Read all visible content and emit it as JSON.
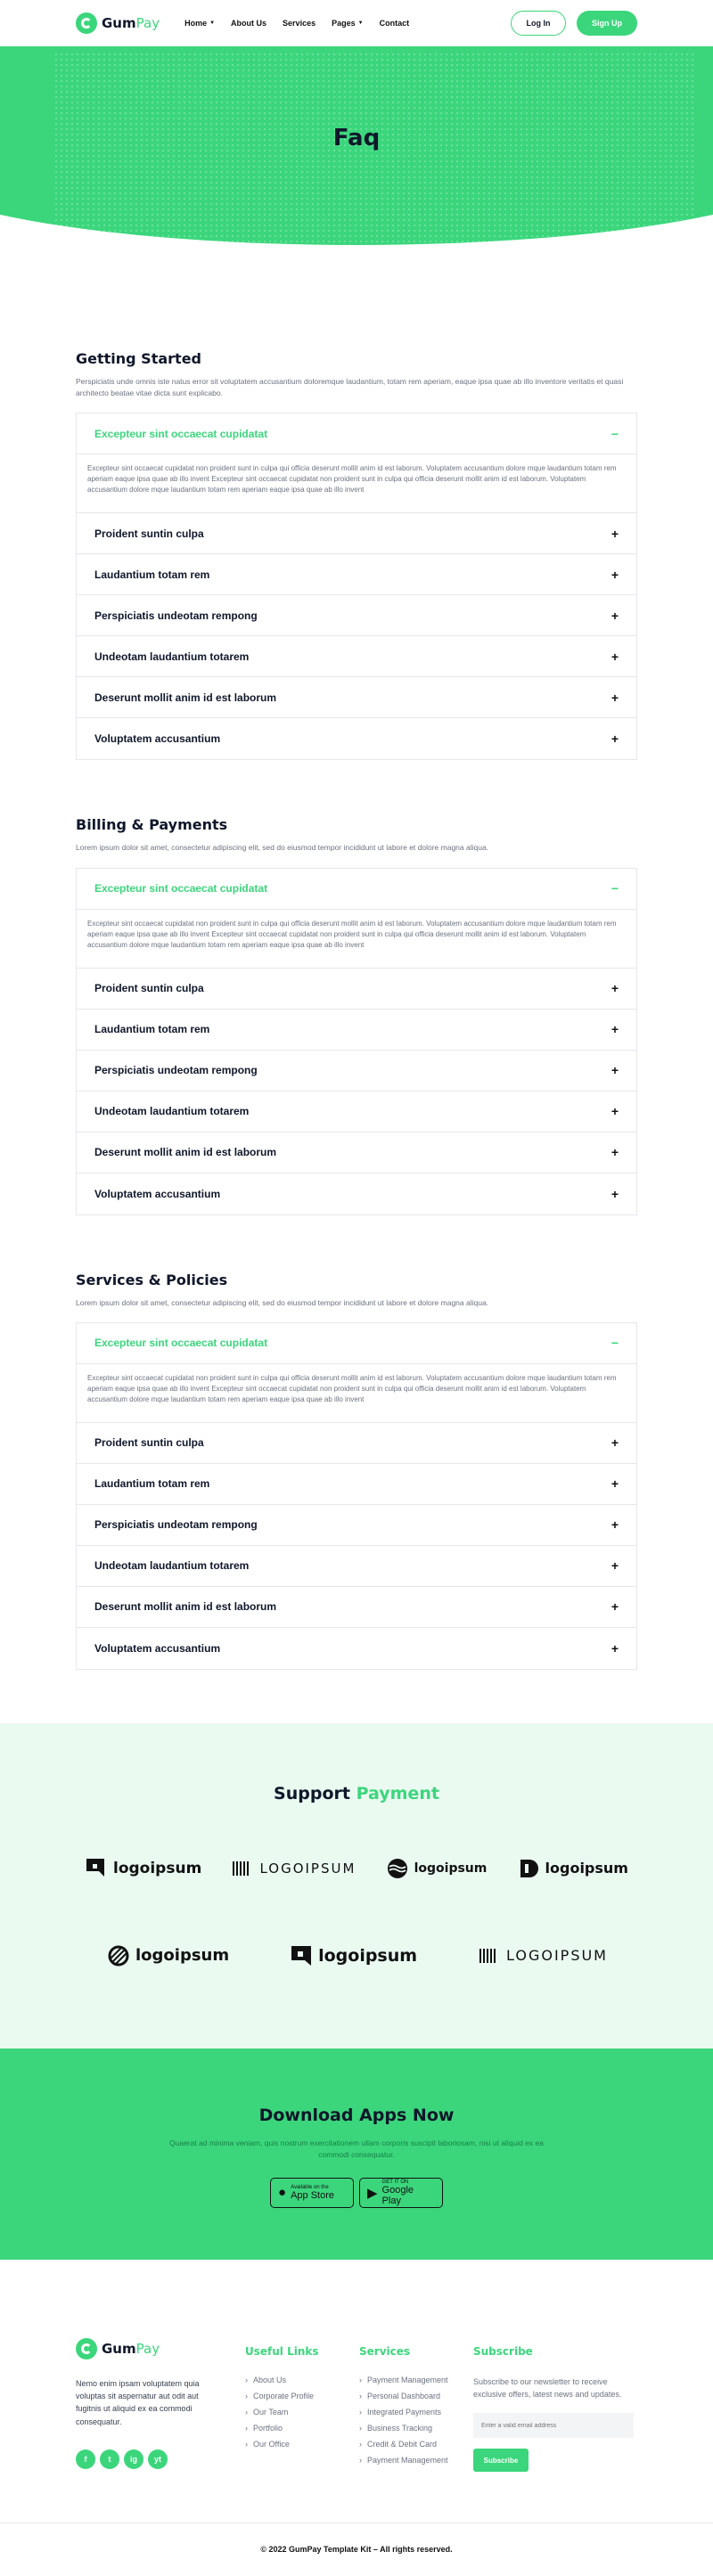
{
  "brand": {
    "name_part1": "Gum",
    "name_part2": "Pay",
    "accent": "#3bd67c",
    "dark": "#0f172a"
  },
  "nav": {
    "items": [
      {
        "label": "Home",
        "has_caret": true
      },
      {
        "label": "About Us",
        "has_caret": false
      },
      {
        "label": "Services",
        "has_caret": false
      },
      {
        "label": "Pages",
        "has_caret": true
      },
      {
        "label": "Contact",
        "has_caret": false
      }
    ],
    "login_label": "Log In",
    "signup_label": "Sign Up"
  },
  "hero": {
    "title": "Faq"
  },
  "faq_sections": [
    {
      "title": "Getting Started",
      "desc": "Perspiciatis unde omnis iste natus error sit voluptatem accusantium doloremque laudantium, totam rem aperiam, eaque ipsa quae ab illo inventore veritatis et quasi architecto beatae vitae dicta sunt explicabo.",
      "open_q": "Excepteur sint occaecat cupidatat",
      "open_a": "Excepteur sint occaecat cupidatat non proident sunt in culpa qui officia deserunt mollit anim id est laborum. Voluptatem accusantium dolore mque laudantium totam rem aperiam eaque ipsa quae ab illo invent Excepteur sint occaecat cupidatat non proident sunt in culpa qui officia deserunt mollit anim id est laborum. Voluptatem accusantium dolore mque laudantium totam rem aperiam eaque ipsa quae ab illo invent",
      "questions": [
        "Proident suntin culpa",
        "Laudantium totam rem",
        "Perspiciatis undeotam rempong",
        "Undeotam laudantium totarem",
        "Deserunt mollit anim id est laborum",
        "Voluptatem accusantium"
      ]
    },
    {
      "title": "Billing & Payments",
      "desc": "Lorem ipsum dolor sit amet, consectetur adipiscing elit, sed do eiusmod tempor incididunt ut labore et dolore magna aliqua.",
      "open_q": "Excepteur sint occaecat cupidatat",
      "open_a": "Excepteur sint occaecat cupidatat non proident sunt in culpa qui officia deserunt mollit anim id est laborum. Voluptatem accusantium dolore mque laudantium totam rem aperiam eaque ipsa quae ab illo invent Excepteur sint occaecat cupidatat non proident sunt in culpa qui officia deserunt mollit anim id est laborum. Voluptatem accusantium dolore mque laudantium totam rem aperiam eaque ipsa quae ab illo invent",
      "questions": [
        "Proident suntin culpa",
        "Laudantium totam rem",
        "Perspiciatis undeotam rempong",
        "Undeotam laudantium totarem",
        "Deserunt mollit anim id est laborum",
        "Voluptatem accusantium"
      ]
    },
    {
      "title": "Services & Policies",
      "desc": "Lorem ipsum dolor sit amet, consectetur adipiscing elit, sed do eiusmod tempor incididunt ut labore et dolore magna aliqua.",
      "open_q": "Excepteur sint occaecat cupidatat",
      "open_a": "Excepteur sint occaecat cupidatat non proident sunt in culpa qui officia deserunt mollit anim id est laborum. Voluptatem accusantium dolore mque laudantium totam rem aperiam eaque ipsa quae ab illo invent Excepteur sint occaecat cupidatat non proident sunt in culpa qui officia deserunt mollit anim id est laborum. Voluptatem accusantium dolore mque laudantium totam rem aperiam eaque ipsa quae ab illo invent",
      "questions": [
        "Proident suntin culpa",
        "Laudantium totam rem",
        "Perspiciatis undeotam rempong",
        "Undeotam laudantium totarem",
        "Deserunt mollit anim id est laborum",
        "Voluptatem accusantium"
      ]
    }
  ],
  "support": {
    "title_part1": "Support",
    "title_part2": "Payment",
    "logos_row1": [
      "logoipsum",
      "LOGOIPSUM",
      "logoipsum",
      "logoipsum"
    ],
    "logos_row2": [
      "logoipsum",
      "logoipsum",
      "LOGOIPSUM"
    ]
  },
  "download": {
    "title": "Download Apps Now",
    "desc": "Quaerat ad minima veniam, quis nostrum exercitationem ullam corporis suscipit laboriosam, nisi ut aliquid ex ea commodi consequatur.",
    "appstore_small": "Available on the",
    "appstore_big": "App Store",
    "googleplay_small": "GET IT ON",
    "googleplay_big": "Google Play"
  },
  "footer": {
    "desc": "Nemo enim ipsam voluptatem quia voluptas sit aspernatur aut odit aut fugitnis ut aliquid ex ea commodi consequatur.",
    "socials": [
      "f",
      "t",
      "ig",
      "yt"
    ],
    "useful_links_title": "Useful Links",
    "useful_links": [
      "About Us",
      "Corporate Profile",
      "Our Team",
      "Portfolio",
      "Our Office"
    ],
    "services_title": "Services",
    "services": [
      "Payment Management",
      "Personal Dashboard",
      "Integrated Payments",
      "Business Tracking",
      "Credit & Debit Card",
      "Payment Management"
    ],
    "subscribe_title": "Subscribe",
    "subscribe_text": "Subscribe to our newsletter to receive exclusive offers, latest news and updates.",
    "email_placeholder": "Enter a valid email address",
    "subscribe_button": "Subscribe"
  },
  "copyright": "© 2022 GumPay Template Kit – All rights reserved."
}
